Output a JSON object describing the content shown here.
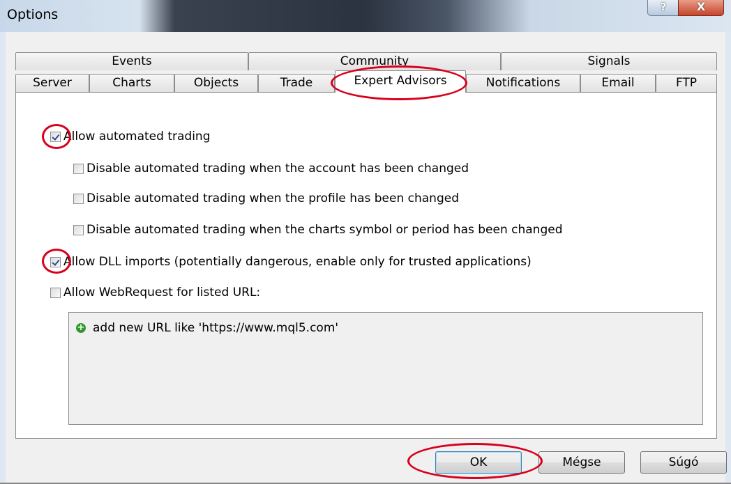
{
  "window": {
    "title": "Options",
    "help_glyph": "?",
    "close_glyph": "X"
  },
  "tabs": {
    "row_top": [
      {
        "label": "Events"
      },
      {
        "label": "Community"
      },
      {
        "label": "Signals"
      }
    ],
    "row_bottom": [
      {
        "label": "Server"
      },
      {
        "label": "Charts"
      },
      {
        "label": "Objects"
      },
      {
        "label": "Trade"
      },
      {
        "label": "Expert Advisors",
        "active": true
      },
      {
        "label": "Notifications"
      },
      {
        "label": "Email"
      },
      {
        "label": "FTP"
      }
    ]
  },
  "options": {
    "allow_automated_trading": {
      "label": "Allow automated trading",
      "checked": true
    },
    "disable_on_account_change": {
      "label": "Disable automated trading when the account has been changed",
      "checked": false
    },
    "disable_on_profile_change": {
      "label": "Disable automated trading when the profile has been changed",
      "checked": false
    },
    "disable_on_symbol_change": {
      "label": "Disable automated trading when the charts symbol or period has been changed",
      "checked": false
    },
    "allow_dll_imports": {
      "label": "Allow DLL imports (potentially dangerous, enable only for trusted applications)",
      "checked": true
    },
    "allow_webrequest": {
      "label": "Allow WebRequest for listed URL:",
      "checked": false
    }
  },
  "url_list": {
    "add_item_label": "add new URL like 'https://www.mql5.com'",
    "add_icon": "plus-circle-icon"
  },
  "buttons": {
    "ok": "OK",
    "cancel": "Mégse",
    "help": "Súgó"
  },
  "colors": {
    "annotation": "#d8001c",
    "check": "#2b4a91",
    "add_icon": "#2f9a2f"
  }
}
